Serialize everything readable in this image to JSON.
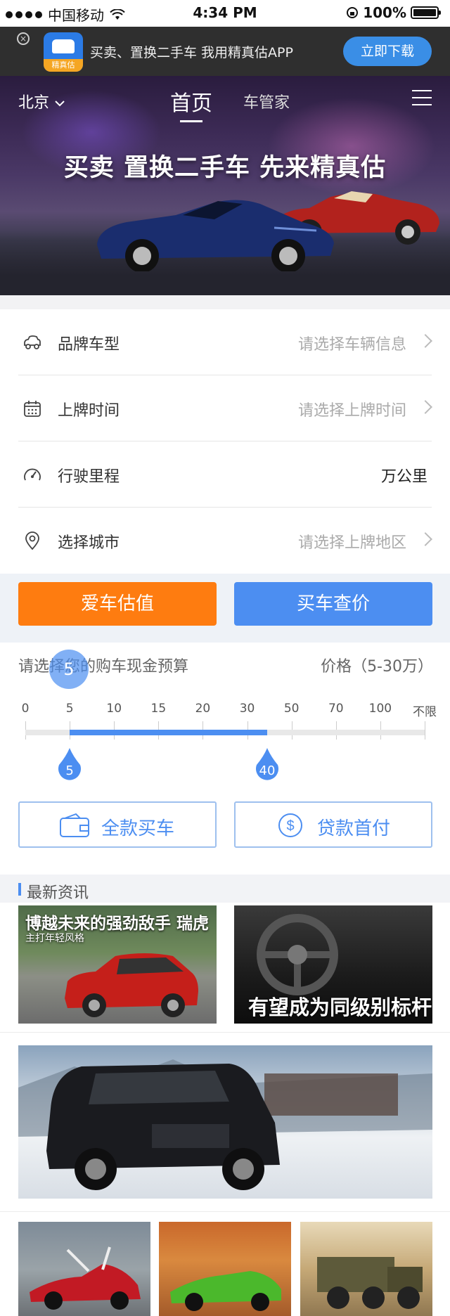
{
  "status_bar": {
    "carrier": "中国移动",
    "time": "4:34 PM",
    "battery": "100%"
  },
  "app_banner": {
    "app_name": "精真估",
    "tagline": "买卖、置换二手车 我用精真估APP",
    "download_label": "立即下载"
  },
  "hero": {
    "city": "北京",
    "tabs": [
      {
        "label": "首页",
        "active": true
      },
      {
        "label": "车管家",
        "active": false
      }
    ],
    "slogan": "买卖 置换二手车 先来精真估"
  },
  "form": {
    "rows": [
      {
        "label": "品牌车型",
        "value": "请选择车辆信息",
        "icon": "car-outline-icon"
      },
      {
        "label": "上牌时间",
        "value": "请选择上牌时间",
        "icon": "calendar-icon"
      },
      {
        "label": "行驶里程",
        "value": "万公里",
        "icon": "speedometer-icon"
      },
      {
        "label": "选择城市",
        "value": "请选择上牌地区",
        "icon": "location-pin-icon"
      }
    ]
  },
  "actions": {
    "valuation": "爱车估值",
    "buy_price": "买车查价"
  },
  "budget": {
    "title": "请选择您的购车现金预算",
    "price_label": "价格（5-30万）",
    "bubble_value": "5",
    "ticks": [
      "0",
      "5",
      "10",
      "15",
      "20",
      "30",
      "50",
      "70",
      "100",
      "不限"
    ],
    "min_handle": "5",
    "max_handle": "40",
    "min_index": 1,
    "max_index": 5.45,
    "full_pay": "全款买车",
    "loan_pay": "贷款首付"
  },
  "news": {
    "header": "最新资讯",
    "card1_headline": "博越未来的强劲敌手 瑞虎",
    "card1_sub": "主打年轻风格",
    "card2_headline": "有望成为同级别标杆"
  },
  "colors": {
    "accent_blue": "#4c8ef1",
    "accent_orange": "#fe7c10"
  }
}
